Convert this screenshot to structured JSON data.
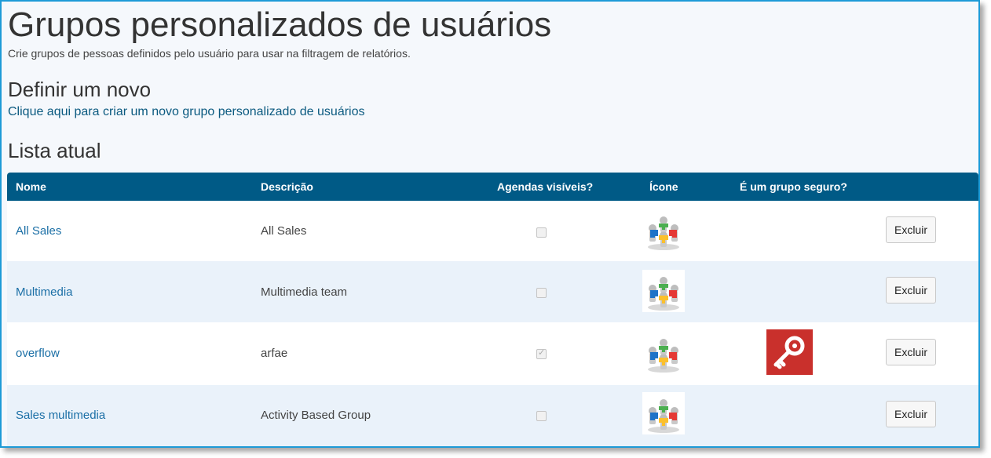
{
  "header": {
    "title": "Grupos personalizados de usuários",
    "subtitle": "Crie grupos de pessoas definidos pelo usuário para usar na filtragem de relatórios."
  },
  "define_section": {
    "title": "Definir um novo",
    "link": "Clique aqui para criar um novo grupo personalizado de usuários"
  },
  "list_section": {
    "title": "Lista atual"
  },
  "table": {
    "columns": {
      "name": "Nome",
      "description": "Descrição",
      "visible": "Agendas visíveis?",
      "icon": "Ícone",
      "secure": "É um grupo seguro?"
    },
    "rows": [
      {
        "name": "All Sales",
        "description": "All Sales",
        "calendars_visible": false,
        "icon": "group-people-icon",
        "secure": false,
        "delete_label": "Excluir"
      },
      {
        "name": "Multimedia",
        "description": "Multimedia team",
        "calendars_visible": false,
        "icon": "group-people-icon",
        "secure": false,
        "delete_label": "Excluir"
      },
      {
        "name": "overflow",
        "description": "arfae",
        "calendars_visible": true,
        "icon": "group-people-icon",
        "secure": true,
        "secure_icon": "key-icon",
        "delete_label": "Excluir"
      },
      {
        "name": "Sales multimedia",
        "description": "Activity Based Group",
        "calendars_visible": false,
        "icon": "group-people-icon",
        "secure": false,
        "delete_label": "Excluir"
      }
    ]
  },
  "colors": {
    "header_bg": "#005a86",
    "link": "#1b6fa6",
    "frame_border": "#1e9bd7",
    "alt_row": "#eaf2fa",
    "key_bg": "#c9302c"
  }
}
